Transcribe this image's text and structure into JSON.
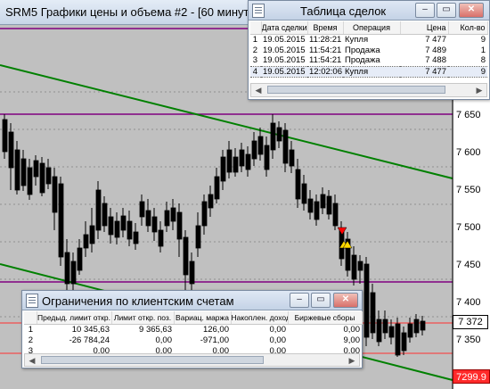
{
  "chart_window": {
    "title": "SRM5 Графики цены и объема #2 - [60 минут]",
    "price_labels": [
      "7 650",
      "7 600",
      "7 550",
      "7 500",
      "7 450",
      "7 400",
      "7 350"
    ],
    "current_price": "7 372",
    "bottom_price": "7299.9"
  },
  "deals": {
    "title": "Таблица сделок",
    "columns": [
      "",
      "Дата сделки",
      "Время",
      "Операция",
      "Цена",
      "Кол-во"
    ],
    "rows": [
      [
        "1",
        "19.05.2015",
        "11:28:21",
        "Купля",
        "7 477",
        "9"
      ],
      [
        "2",
        "19.05.2015",
        "11:54:21",
        "Продажа",
        "7 489",
        "1"
      ],
      [
        "3",
        "19.05.2015",
        "11:54:21",
        "Продажа",
        "7 488",
        "8"
      ],
      [
        "4",
        "19.05.2015",
        "12:02:06",
        "Купля",
        "7 477",
        "9"
      ]
    ]
  },
  "limits": {
    "title": "Ограничения по клиентским счетам",
    "columns": [
      "",
      "Предыд. лимит откр.",
      "Лимит откр. поз.",
      "Вариац. маржа",
      "Накоплен. доход",
      "Биржевые сборы"
    ],
    "rows": [
      [
        "1",
        "10 345,63",
        "9 365,63",
        "126,00",
        "0,00",
        "0,00"
      ],
      [
        "2",
        "-26 784,24",
        "0,00",
        "-971,00",
        "0,00",
        "9,00"
      ],
      [
        "3",
        "0,00",
        "0,00",
        "0,00",
        "0,00",
        "0,00"
      ]
    ]
  },
  "window_buttons": {
    "minimize": "‒",
    "maximize": "▭",
    "close": "✕"
  },
  "colors": {
    "bull": "#ffffff",
    "bear": "#000000",
    "trend_line": "#008000",
    "level_line": "#800080",
    "current_price_line": "#ff3030",
    "sell_arrow": "#ff0000",
    "buy_arrow": "#ffd700"
  }
}
